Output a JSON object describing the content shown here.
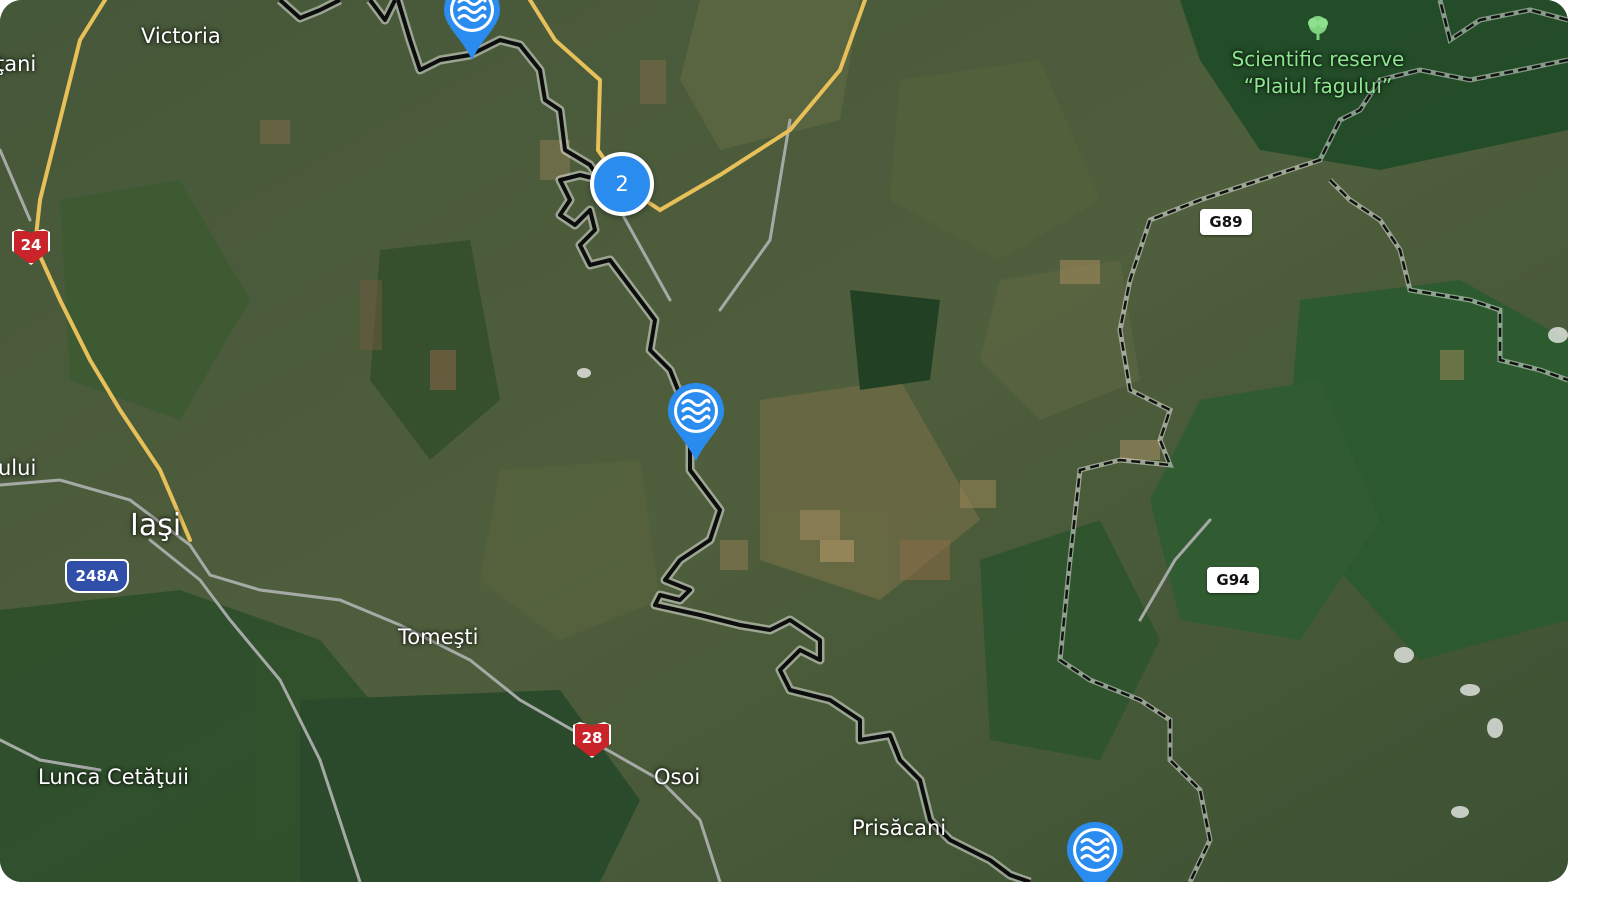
{
  "map": {
    "type": "satellite",
    "places": {
      "victoria": "Victoria",
      "tani": "ţani",
      "ului": "ului",
      "iasi": "Iaşi",
      "tomesti": "Tomeşti",
      "lunca": "Lunca Cetăţuii",
      "osoi": "Osoi",
      "prisacani": "Prisăcani",
      "reserve_line1": "Scientific reserve",
      "reserve_line2": "“Plaiul fagului”"
    },
    "road_shields": {
      "r24": "24",
      "r248a": "248A",
      "r28": "28",
      "g89": "G89",
      "g94": "G94"
    },
    "markers": {
      "cluster_count": "2",
      "water_icon": "water-waves-icon"
    },
    "colors": {
      "marker_blue": "#2b8cf0",
      "yellow_road": "#e8c05a",
      "border_line": "#111111",
      "reserve_text": "#8ce68e"
    }
  }
}
